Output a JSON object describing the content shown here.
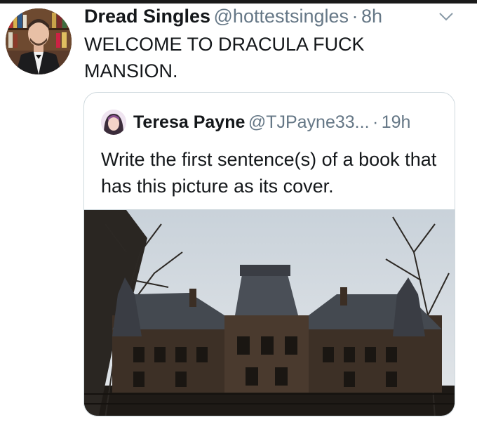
{
  "tweet": {
    "display_name": "Dread Singles",
    "handle": "@hottestsingles",
    "separator": "·",
    "time": "8h",
    "text": "WELCOME TO DRACULA FUCK MANSION."
  },
  "quoted_tweet": {
    "display_name": "Teresa Payne",
    "handle": "@TJPayne33...",
    "separator": "·",
    "time": "19h",
    "text": "Write the first sentence(s) of a book that has this picture as its cover."
  },
  "colors": {
    "text_primary": "#14171a",
    "text_secondary": "#657786",
    "border": "#cfd9de"
  },
  "icons": {
    "caret": "chevron-down-icon"
  }
}
